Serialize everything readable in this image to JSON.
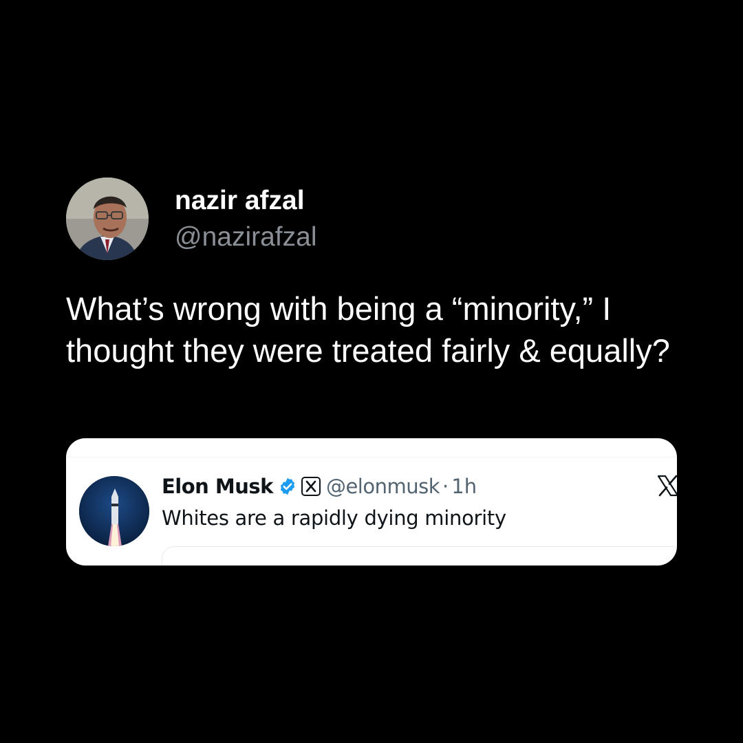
{
  "post": {
    "author_name": "nazir afzal",
    "author_handle": "@nazirafzal",
    "text": "What’s wrong with being a “minority,” I thought they were treated fairly & equally?"
  },
  "quoted_post": {
    "author_name": "Elon Musk",
    "author_handle": "@elonmusk",
    "separator": "·",
    "time": "1h",
    "text": "Whites are a rapidly dying minority"
  },
  "icons": {
    "verified": "verified-badge-icon",
    "affiliate": "x-badge-icon",
    "platform": "x-logo-icon"
  },
  "colors": {
    "background": "#000000",
    "verified_blue": "#1d9bf0",
    "secondary_text": "#536471"
  }
}
